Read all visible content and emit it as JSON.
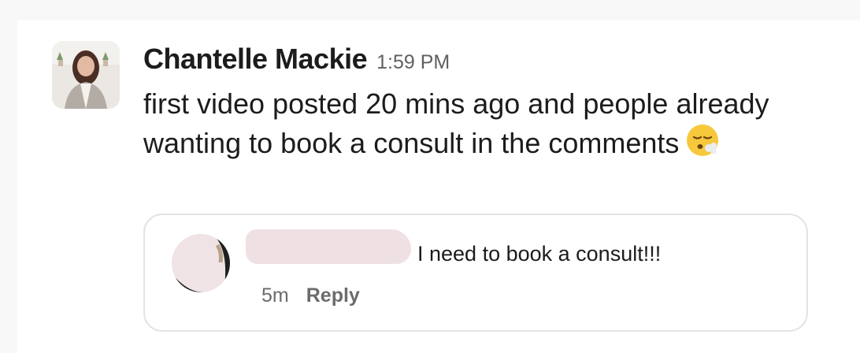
{
  "message": {
    "author": "Chantelle Mackie",
    "time": "1:59 PM",
    "text": "first video posted 20 mins ago and people already wanting to book a consult in the comments",
    "emoji": "face-exhaling-emoji"
  },
  "attachment": {
    "comment_text": "I need to book a consult!!!",
    "age": "5m",
    "reply_label": "Reply"
  },
  "colors": {
    "text": "#1d1c1d",
    "muted": "#616061",
    "card_border": "#e3e3e3",
    "redaction": "#efe1e3"
  }
}
